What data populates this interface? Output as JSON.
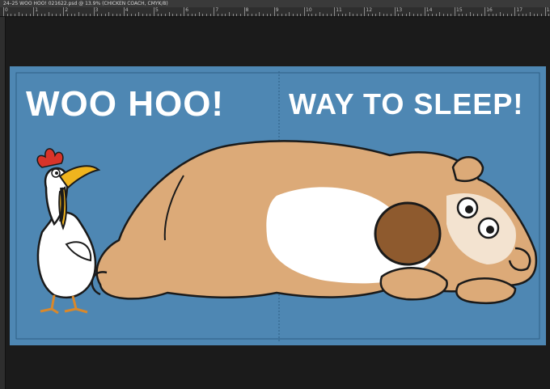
{
  "window": {
    "title": "24–25 WOO HOO! 021622.psd @ 13.9% (CHICKEN COACH, CMYK/8)"
  },
  "ruler": {
    "labels": [
      "0",
      "1",
      "2",
      "3",
      "4",
      "5",
      "6",
      "7",
      "8",
      "9",
      "10",
      "11",
      "12",
      "13",
      "14",
      "15",
      "16",
      "17",
      "18"
    ]
  },
  "artwork": {
    "headline_left": "WOO HOO!",
    "headline_right": "WAY TO SLEEP!",
    "background_color": "#4e87b3",
    "characters": [
      "chicken",
      "sleeping-dog"
    ]
  }
}
